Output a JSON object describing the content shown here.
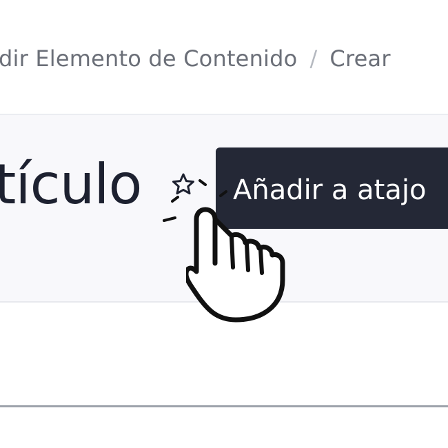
{
  "breadcrumb": {
    "item_1": "dir Elemento de Contenido",
    "separator": "/",
    "item_2": "Crear"
  },
  "header": {
    "title": "tículo"
  },
  "tooltip": {
    "text": "Añadir a atajo"
  },
  "icons": {
    "favorite": "star-outline-icon",
    "pointer": "hand-pointer-cursor-icon"
  },
  "colors": {
    "tooltip_bg": "#242836",
    "title_text": "#1d2130",
    "breadcrumb_text": "#6b6f78",
    "panel_bg": "#f8f8fb"
  }
}
